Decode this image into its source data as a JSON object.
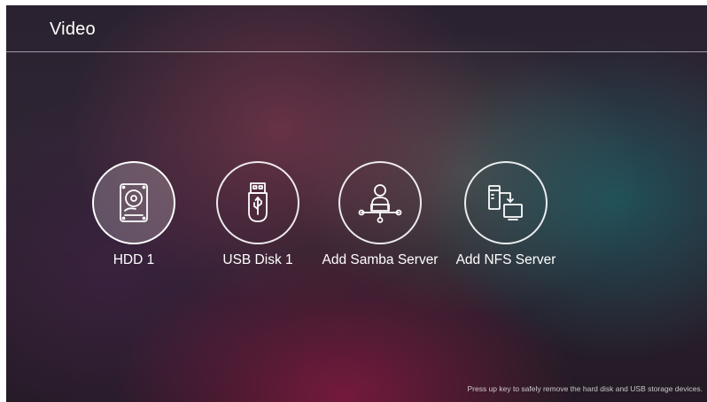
{
  "header": {
    "title": "Video"
  },
  "sources": [
    {
      "label": "HDD 1",
      "icon": "hard-disk-icon",
      "selected": true
    },
    {
      "label": "USB Disk 1",
      "icon": "usb-drive-icon",
      "selected": false
    },
    {
      "label": "Add Samba Server",
      "icon": "samba-network-icon",
      "selected": false
    },
    {
      "label": "Add NFS Server",
      "icon": "nfs-server-icon",
      "selected": false
    }
  ],
  "footer": {
    "hint": "Press up key to safely remove the hard disk and USB storage devices."
  },
  "colors": {
    "text": "#ffffff",
    "icon_stroke": "#ffffff",
    "selected_fill": "rgba(255,255,255,0.22)"
  }
}
